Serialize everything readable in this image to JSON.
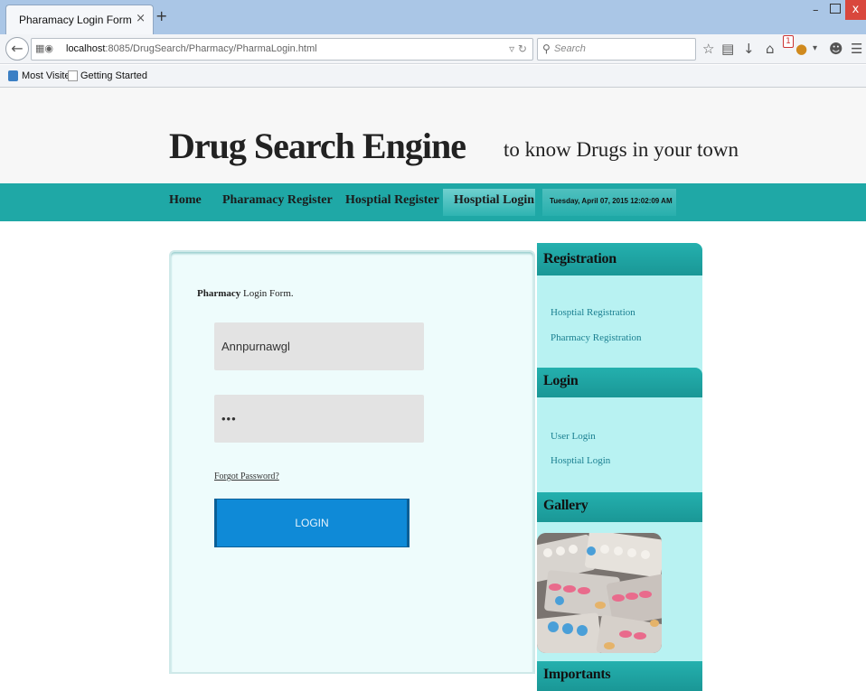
{
  "browser": {
    "tab_title": "Pharamacy Login Form",
    "tab_close": "×",
    "new_tab": "+",
    "url_host": "localhost",
    "url_path": ":8085/DrugSearch/Pharmacy/PharmaLogin.html",
    "search_placeholder": "Search",
    "window_min": "–",
    "window_close": "x",
    "badge_count": "1",
    "bookmarks": [
      "Most Visited",
      "Getting Started"
    ]
  },
  "header": {
    "title": "Drug Search Engine",
    "tagline": "to know Drugs in your town"
  },
  "menu": {
    "items": [
      "Home",
      "Pharamacy Register",
      "Hosptial Register",
      "Hosptial Login"
    ],
    "datetime": "Tuesday, April 07, 2015 12:02:09 AM"
  },
  "form": {
    "title_bold": "Pharmacy",
    "title_rest": " Login Form.",
    "username_value": "Annpurnawgl",
    "password_value": "•••",
    "forgot_label": "Forgot Password?",
    "login_label": "LOGIN"
  },
  "sidebar": {
    "registration_heading": "Registration",
    "registration_links": [
      "Hosptial Registration",
      "Pharmacy Registration"
    ],
    "login_heading": "Login",
    "login_links": [
      "User Login",
      "Hosptial Login"
    ],
    "gallery_heading": "Gallery",
    "importants_heading": "Importants"
  },
  "colors": {
    "menu_bar": "#1fa8a6",
    "sidebar_bg": "#b8f2f2",
    "login_button": "#0f8ad7",
    "link": "#1a7f90"
  }
}
